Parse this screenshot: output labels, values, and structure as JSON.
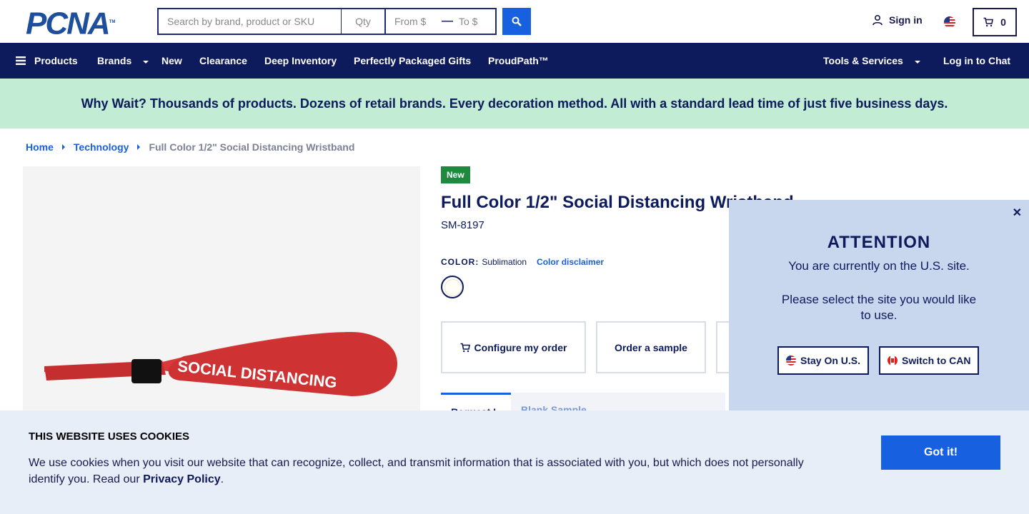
{
  "header": {
    "logo_text": "PCNA",
    "search_placeholder": "Search by brand, product or SKU",
    "qty_placeholder": "Qty",
    "from_placeholder": "From $",
    "to_placeholder": "To $",
    "signin_label": "Sign in",
    "cart_count": "0"
  },
  "nav": {
    "products": "Products",
    "brands": "Brands",
    "new": "New",
    "clearance": "Clearance",
    "deep_inventory": "Deep Inventory",
    "gifts": "Perfectly Packaged Gifts",
    "proudpath": "ProudPath™",
    "tools": "Tools & Services",
    "chat": "Log in to Chat"
  },
  "banner": {
    "text": "Why Wait? Thousands of products. Dozens of retail brands. Every decoration method. All with a standard lead time of just five business days."
  },
  "breadcrumb": {
    "home": "Home",
    "category": "Technology",
    "current": "Full Color 1/2\" Social Distancing Wristband"
  },
  "product": {
    "image_text": "SOCIAL DISTANCING",
    "badge": "New",
    "title": "Full Color 1/2\" Social Distancing Wristband",
    "sku": "SM-8197",
    "color_label": "COLOR:",
    "color_value": "Sublimation",
    "color_disclaimer": "Color disclaimer",
    "configure_label": "Configure my order",
    "sample_label": "Order a sample"
  },
  "tabs": {
    "active": "Request I",
    "inactive": "Blank    Sample"
  },
  "popup": {
    "title": "ATTENTION",
    "line1": "You are currently on the U.S. site.",
    "line2": "Please select the site you would like to use.",
    "stay_label": "Stay On U.S.",
    "switch_label": "Switch to CAN"
  },
  "cookie": {
    "title": "THIS WEBSITE USES COOKIES",
    "text": "We use cookies when you visit our website that can recognize, collect, and transmit information that is associated with you, but which does not personally identify you. Read our",
    "link": "Privacy Policy",
    "tail": ".",
    "button": "Got it!"
  },
  "colors": {
    "navy": "#0d1a5c",
    "blue": "#1761e0",
    "banner_green": "#c2ecd3",
    "popup_bg": "#c8d6ee",
    "cookie_bg": "#e8eef8",
    "wristband_red": "#d8393a"
  }
}
